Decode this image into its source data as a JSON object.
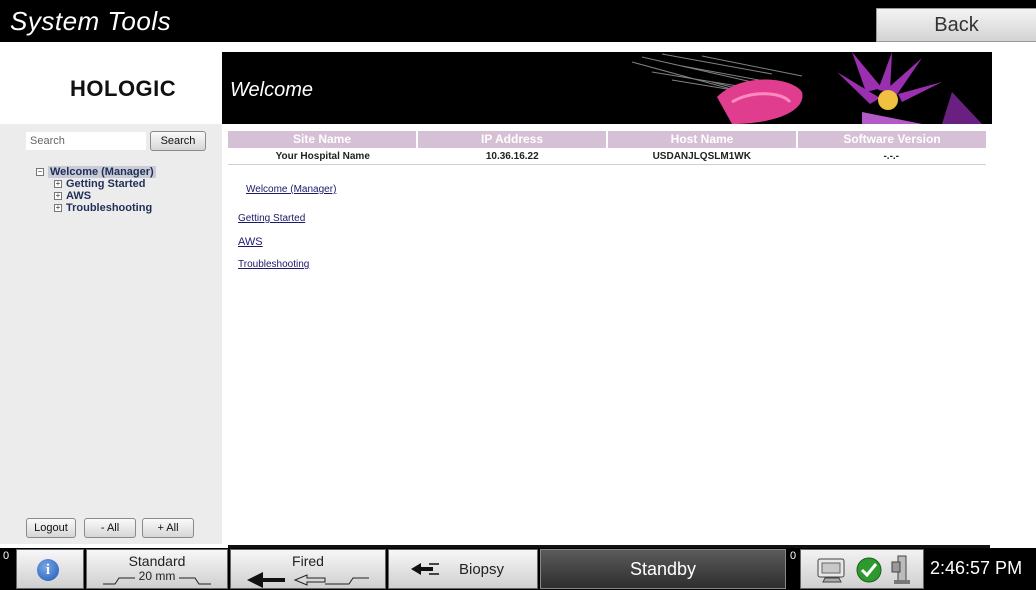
{
  "window": {
    "title": "System Tools",
    "back_label": "Back"
  },
  "logo": {
    "text": "HOLOGIC"
  },
  "banner": {
    "title": "Welcome"
  },
  "sidebar": {
    "search_placeholder": "Search",
    "search_button": "Search",
    "tree": {
      "root": "Welcome (Manager)",
      "children": [
        "Getting Started",
        "AWS",
        "Troubleshooting"
      ]
    },
    "logout_label": "Logout",
    "collapse_all_label": "- All",
    "expand_all_label": "+ All"
  },
  "info_table": {
    "headers": [
      "Site Name",
      "IP Address",
      "Host Name",
      "Software Version"
    ],
    "row": [
      "Your Hospital Name",
      "10.36.16.22",
      "USDANJLQSLM1WK",
      "-.-.-"
    ]
  },
  "content_links": {
    "welcome": "Welcome (Manager)",
    "getting_started": "Getting Started",
    "aws": "AWS",
    "troubleshooting": "Troubleshooting"
  },
  "taskbar": {
    "left_counter": "0",
    "info_icon": "info-icon",
    "standard_label": "Standard",
    "standard_value": "20 mm",
    "fired_label": "Fired",
    "biopsy_label": "Biopsy",
    "status": "Standby",
    "status_counter": "0",
    "clock": "2:46:57 PM"
  },
  "colors": {
    "title_bar": "#000000",
    "table_header": "#d6c0d6",
    "sidebar_bg": "#ececec",
    "link": "#1a1a6b"
  }
}
